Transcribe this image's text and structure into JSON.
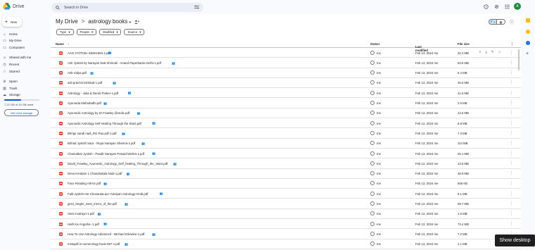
{
  "app": {
    "logo_text": "Drive",
    "avatar_letter": "A"
  },
  "search": {
    "placeholder": "Search in Drive"
  },
  "sidebar": {
    "new_label": "New",
    "items": [
      {
        "label": "Home",
        "icon": "home-icon"
      },
      {
        "label": "My Drive",
        "icon": "my-drive-icon"
      },
      {
        "label": "Computers",
        "icon": "computers-icon"
      },
      {
        "label": "Shared with me",
        "icon": "shared-icon"
      },
      {
        "label": "Recent",
        "icon": "clock-icon"
      },
      {
        "label": "Starred",
        "icon": "star-icon"
      },
      {
        "label": "Spam",
        "icon": "spam-icon"
      },
      {
        "label": "Trash",
        "icon": "trash-icon"
      },
      {
        "label": "Storage",
        "icon": "cloud-icon"
      }
    ],
    "storage_used_fraction": 0.48,
    "storage_text": "7.22 GB of 15 GB used",
    "get_storage_label": "Get more storage"
  },
  "breadcrumb": {
    "root": "My Drive",
    "sep": ">",
    "folder": "astrology books",
    "folder_caret": "▾"
  },
  "filters": [
    {
      "label": "Type"
    },
    {
      "label": "People"
    },
    {
      "label": "Modified"
    },
    {
      "label": "Source"
    }
  ],
  "columns": {
    "name": "Name",
    "owner": "Owner",
    "last_modified": "Last modified",
    "file_size": "File size"
  },
  "files": [
    {
      "name": "AAO JYOTISH SEEKHEN-1.pdf",
      "owner": "me",
      "date": "Feb 13, 2024 me",
      "size": "22.4 MB"
    },
    {
      "name": "Ank Jyotish by Narayan Datt Shrimali - Anand Paperbacks Delhi-1.pdf",
      "owner": "me",
      "date": "Feb 13, 2024 me",
      "size": "53.9 MB"
    },
    {
      "name": "Ank-Vidya.pdf",
      "owner": "me",
      "date": "Feb 13, 2024 me",
      "size": "6.4 MB"
    },
    {
      "name": "asli-prachin-lal-kitab-1.pdf",
      "owner": "me",
      "date": "Feb 13, 2024 me",
      "size": "46.5 MB"
    },
    {
      "name": "Astrology - Julia & Derek Parker-1.pdf",
      "owner": "me",
      "date": "Feb 13, 2024 me",
      "size": "41.6 MB"
    },
    {
      "name": "Ayurveda Mahodadhi.pdf",
      "owner": "me",
      "date": "Feb 13, 2024 me",
      "size": "2.6 MB"
    },
    {
      "name": "Ayurvedic Astrology by Dr Frawley @vedic.pdf",
      "owner": "me",
      "date": "Feb 13, 2024 me",
      "size": "13.6 MB"
    },
    {
      "name": "Ayurvedic Astrology Self Healing Through the Stars.pdf",
      "owner": "me",
      "date": "Feb 13, 2024 me",
      "size": "8.8 MB"
    },
    {
      "name": "Bhrigu nandi nadi_RG Rao.pdf-1.pdf",
      "owner": "me",
      "date": "Feb 13, 2024 me",
      "size": "7.3 MB"
    },
    {
      "name": "Brihad Jyotish Sara - Rupa Narayan Sharma-1.pdf",
      "owner": "me",
      "date": "Feb 13, 2024 me",
      "size": "114 MB"
    },
    {
      "name": "Chamatkar Jyotish - Pandit Narayan Prasad Mishra-1.pdf",
      "owner": "me",
      "date": "Feb 13, 2024 me",
      "size": "25.1 MB"
    },
    {
      "name": "David_Frawley_Ayurvedic_Astrology_Self_healing_Through_the_Stars.pdf",
      "owner": "me",
      "date": "Feb 13, 2024 me",
      "size": "13.6 MB"
    },
    {
      "name": "Deva Keralam 1 Chandrakala Nadi-1.pdf",
      "owner": "me",
      "date": "Feb 13, 2024 me",
      "size": "48.9 MB"
    },
    {
      "name": "Face Reading AIFAS.pdf",
      "owner": "me",
      "date": "Feb 13, 2024 me",
      "size": "656 KB"
    },
    {
      "name": "Falit-Jyotish-me-Chunautia-aur-Yuktiyan-Astrology-Hindi.pdf",
      "owner": "me",
      "date": "Feb 13, 2024 me",
      "size": "9.1 MB"
    },
    {
      "name": "gerd_ziegler_tarot_mirror_of_the.pdf",
      "owner": "me",
      "date": "Feb 13, 2024 me",
      "size": "59.7 MB"
    },
    {
      "name": "Hast mudrayn-1.pdf",
      "owner": "me",
      "date": "Feb 13, 2024 me",
      "size": "1.6 MB"
    },
    {
      "name": "Hath Ka Angutha -1.pdf",
      "owner": "me",
      "date": "Feb 13, 2024 me",
      "size": "73.4 MB"
    },
    {
      "name": "How To Use Astrology Advanced - Michael Erlewine-1.pdf",
      "owner": "me",
      "date": "Feb 13, 2024 me",
      "size": "7.2 MB"
    },
    {
      "name": "metapdf.in-numerology-book-667-1.pdf",
      "owner": "me",
      "date": "Feb 13, 2024 me",
      "size": "1.1 MB"
    }
  ],
  "toast": "Show desktop"
}
